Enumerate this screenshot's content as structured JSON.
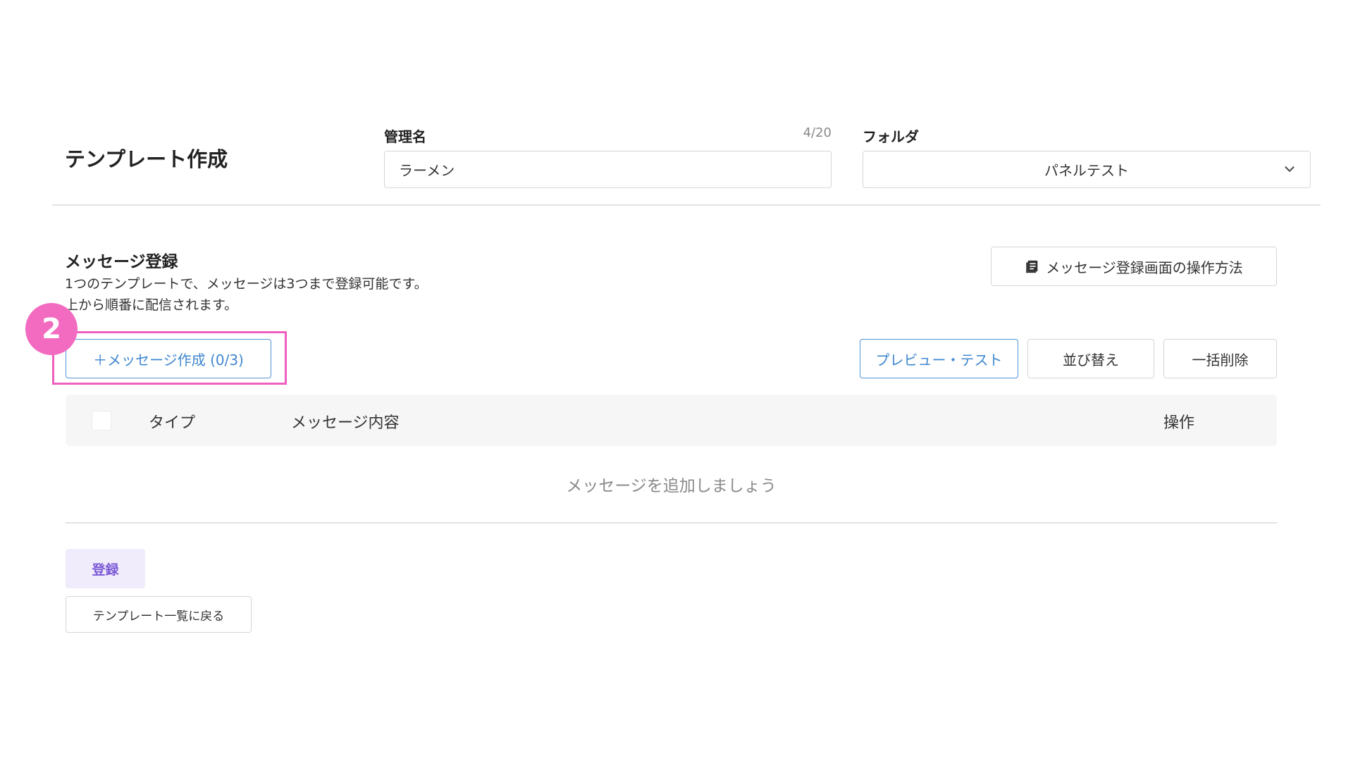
{
  "header": {
    "title": "テンプレート作成",
    "name_field": {
      "label": "管理名",
      "counter": "4/20",
      "value": "ラーメン"
    },
    "folder_field": {
      "label": "フォルダ",
      "selected": "パネルテスト"
    }
  },
  "message_section": {
    "title": "メッセージ登録",
    "description_line1": "1つのテンプレートで、メッセージは3つまで登録可能です。",
    "description_line2": "上から順番に配信されます。",
    "guide_button": "メッセージ登録画面の操作方法",
    "create_button": "＋メッセージ作成 (0/3)",
    "step_badge": "2",
    "actions": {
      "preview": "プレビュー・テスト",
      "sort": "並び替え",
      "bulk_delete": "一括削除"
    }
  },
  "table": {
    "columns": [
      "タイプ",
      "メッセージ内容",
      "操作"
    ],
    "empty_message": "メッセージを追加しましょう"
  },
  "footer": {
    "register_button": "登録",
    "back_button": "テンプレート一覧に戻る"
  },
  "colors": {
    "accent_blue": "#3f87cf",
    "highlight_pink": "#ef5fbf",
    "badge_pink": "#f36bc1",
    "register_purple": "#7b5ad6",
    "register_bg": "#f0ecfb"
  }
}
